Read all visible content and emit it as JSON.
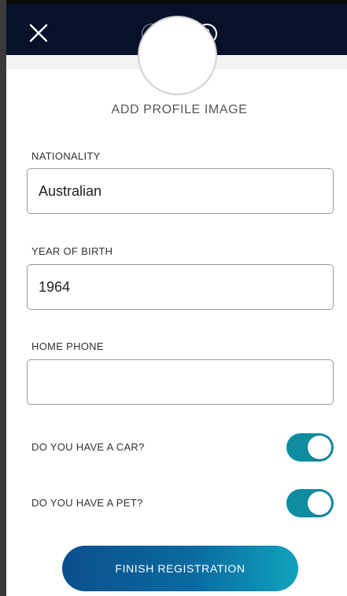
{
  "colors": {
    "topbar": "#07112a",
    "accent": "#0e8da0",
    "button_start": "#0b4f8c",
    "button_end": "#10a2bd"
  },
  "header": {
    "close_icon": "close-icon",
    "steps": [
      "1",
      "2"
    ],
    "current_step": 2
  },
  "profile": {
    "add_label": "ADD PROFILE IMAGE"
  },
  "form": {
    "nationality": {
      "label": "NATIONALITY",
      "value": "Australian"
    },
    "year_of_birth": {
      "label": "YEAR OF BIRTH",
      "value": "1964"
    },
    "home_phone": {
      "label": "HOME PHONE",
      "value": ""
    },
    "has_car": {
      "label": "DO YOU HAVE A CAR?",
      "on": true
    },
    "has_pet": {
      "label": "DO YOU HAVE A PET?",
      "on": true
    }
  },
  "actions": {
    "finish_label": "FINISH REGISTRATION"
  }
}
